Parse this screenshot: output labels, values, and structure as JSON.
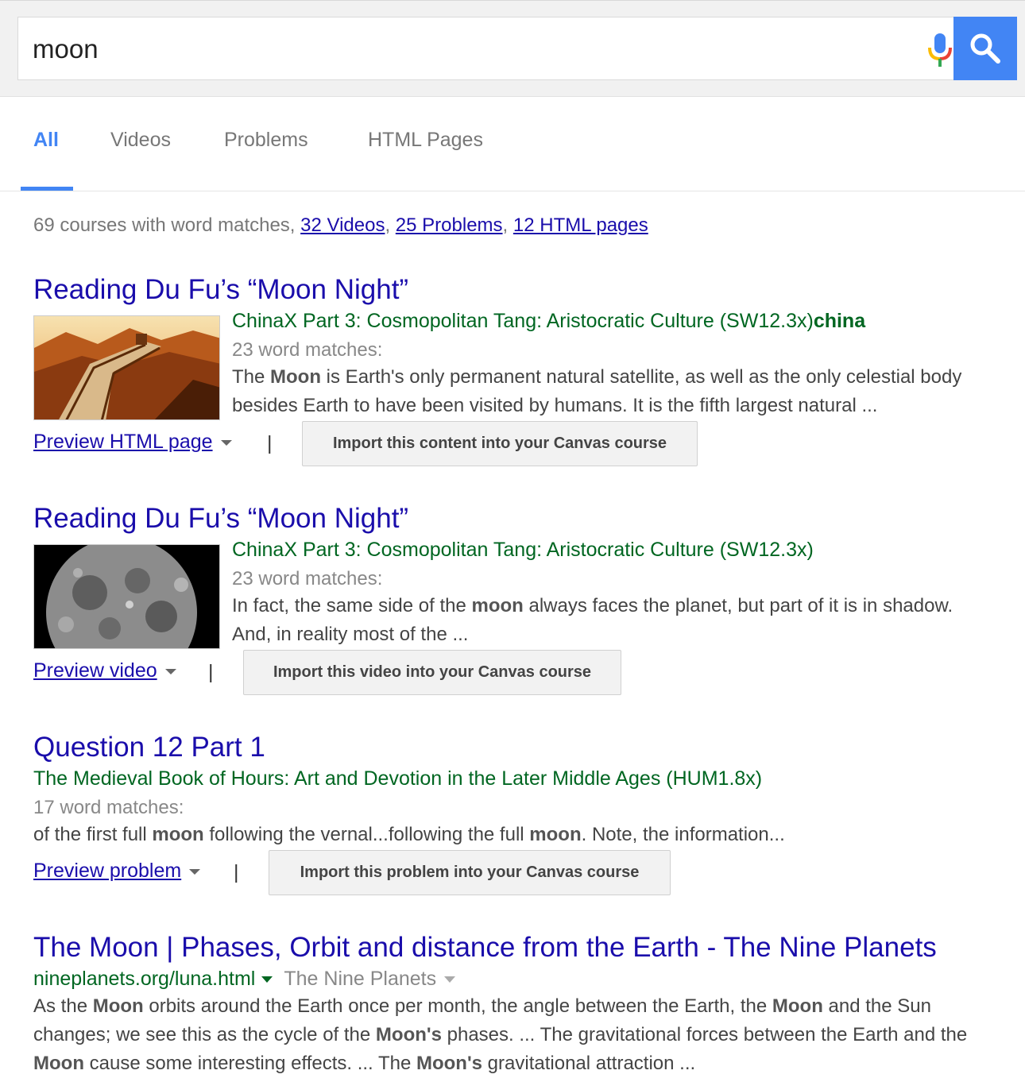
{
  "search": {
    "query": "moon"
  },
  "icons": {
    "mic": "microphone-icon",
    "search": "search-icon",
    "caret": "caret-down-icon"
  },
  "colors": {
    "accent": "#4285f4",
    "link": "#1a0dab",
    "course_green": "#006621"
  },
  "tabs": [
    {
      "label": "All",
      "active": true
    },
    {
      "label": "Videos",
      "active": false
    },
    {
      "label": "Problems",
      "active": false
    },
    {
      "label": "HTML Pages",
      "active": false
    }
  ],
  "summary": {
    "text": "69 courses with word matches, ",
    "videos_link": "32 Videos",
    "comma1": ", ",
    "problems_link": "25 Problems",
    "comma2": ", ",
    "html_link": "12 HTML pages"
  },
  "results": [
    {
      "title": "Reading Du Fu’s “Moon Night”",
      "course": "ChinaX Part 3: Cosmopolitan Tang: Aristocratic Culture (SW12.3x)",
      "course_tag": "china",
      "matches": "23 word matches:",
      "snippet": {
        "p1": "The ",
        "b1": "Moon",
        "p2": " is Earth's only permanent natural satellite, as well as the only celestial body besides Earth to have been visited by humans. It is the fifth largest natural ..."
      },
      "preview_label": "Preview HTML page",
      "separator": "|",
      "import_label": "Import this content into your Canvas course"
    },
    {
      "title": "Reading Du Fu’s “Moon Night”",
      "course": "ChinaX Part 3: Cosmopolitan Tang: Aristocratic Culture (SW12.3x)",
      "matches": "23 word matches:",
      "snippet": {
        "p1": "In fact, the same side of the ",
        "b1": "moon",
        "p2": " always faces the planet, but part of it is in shadow. And, in reality most of the ..."
      },
      "preview_label": "Preview video",
      "separator": "|",
      "import_label": "Import this video into your Canvas course"
    },
    {
      "title": "Question 12 Part 1",
      "course": "The Medieval Book of Hours: Art and Devotion in the Later Middle Ages (HUM1.8x)",
      "matches": "17 word matches:",
      "snippet": {
        "p1": "of the first full ",
        "b1": "moon",
        "p2": " following the vernal...following the full ",
        "b2": "moon",
        "p3": ". Note, the information..."
      },
      "preview_label": "Preview problem",
      "separator": "|",
      "import_label": "Import this problem into your Canvas course"
    },
    {
      "title": "The Moon | Phases, Orbit and distance from the Earth - The Nine Planets",
      "url": "nineplanets.org/luna.html",
      "site_name": "The Nine Planets",
      "snippet": {
        "p1": "As the ",
        "b1": "Moon",
        "p2": " orbits around the Earth once per month, the angle between the Earth, the ",
        "b2": "Moon",
        "p3": " and the Sun changes; we see this as the cycle of the ",
        "b3": "Moon's",
        "p4": " phases. ... The gravitational forces between the Earth and the ",
        "b4": "Moon",
        "p5": " cause some interesting effects. ... The ",
        "b5": "Moon's",
        "p6": " gravitational attraction ..."
      }
    }
  ]
}
